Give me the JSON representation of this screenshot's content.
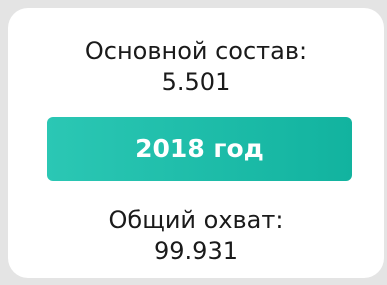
{
  "card": {
    "core_team_label": "Основной состав:",
    "core_team_value": "5.501",
    "year_button_label": "2018 год",
    "total_reach_label": "Общий охват:",
    "total_reach_value": "99.931"
  },
  "colors": {
    "page_background": "#e4e4e4",
    "card_background": "#ffffff",
    "text": "#1a1a1a",
    "button_gradient_start": "#2bc7b4",
    "button_gradient_end": "#12b39f",
    "button_text": "#ffffff"
  }
}
